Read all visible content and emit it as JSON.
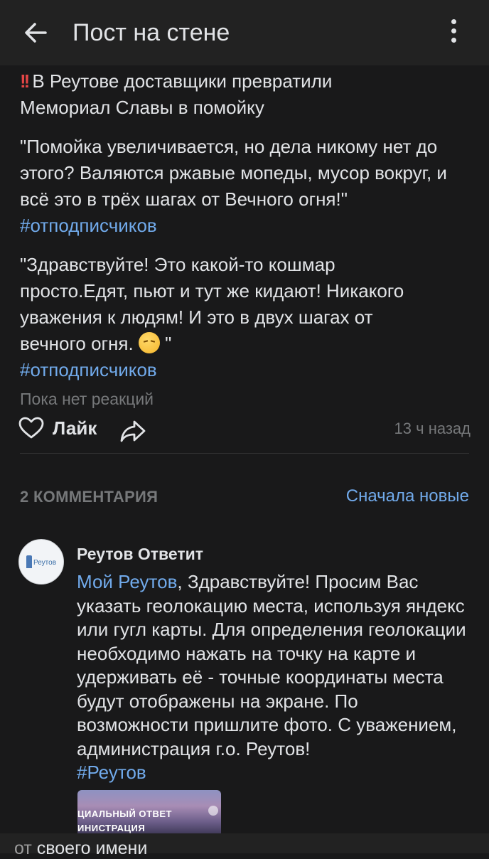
{
  "header": {
    "title": "Пост на стене"
  },
  "post": {
    "title_line1": "В Реутове доставщики превратили",
    "title_line2": "Мемориал Славы в помойку",
    "quote1": "\"Помойка увеличивается, но дела никому нет до этого? Валяются ржавые мопеды, мусор вокруг, и всё это в трёх шагах от Вечного огня!\"",
    "hashtag1": "#отподписчиков",
    "quote2_line1": "\"Здравствуйте! Это какой-то кошмар",
    "quote2_line2": "просто.Едят, пьют и тут же кидают! Никакого",
    "quote2_line3": "уважения к людям! И это в двух шагах от",
    "quote2_line4_a": "вечного огня. ",
    "quote2_line4_b": " \"",
    "hashtag2": "#отподписчиков",
    "reactions_text": "Пока нет реакций",
    "like_label": "Лайк",
    "time": "13 ч назад"
  },
  "comments": {
    "count_label": "2 КОММЕНТАРИЯ",
    "sort_label": "Сначала новые",
    "items": [
      {
        "author": "Реутов Ответит",
        "avatar_text": "Реутов",
        "mention": "Мой Реутов",
        "text": ", Здравствуйте! Просим Вас указать геолокацию места, используя яндекс или гугл карты. Для определения геолокации необходимо нажать на точку на карте и удерживать её - точные координаты места будут отображены на экране. По возможности пришлите фото. С уважением, администрация г.о. Реутов!",
        "hashtag": "#Реутов",
        "attachment_line1": "ЦИАЛЬНЫЙ ОТВЕТ",
        "attachment_line2": "ИНИСТРАЦИЯ"
      }
    ]
  },
  "bottom": {
    "text_dim": "от",
    "text_main": "своего имени"
  },
  "colors": {
    "background": "#19191a",
    "header": "#222222",
    "text": "#e1e3e6",
    "secondary": "#76787a",
    "link": "#71aaeb",
    "warning": "#e64646"
  }
}
